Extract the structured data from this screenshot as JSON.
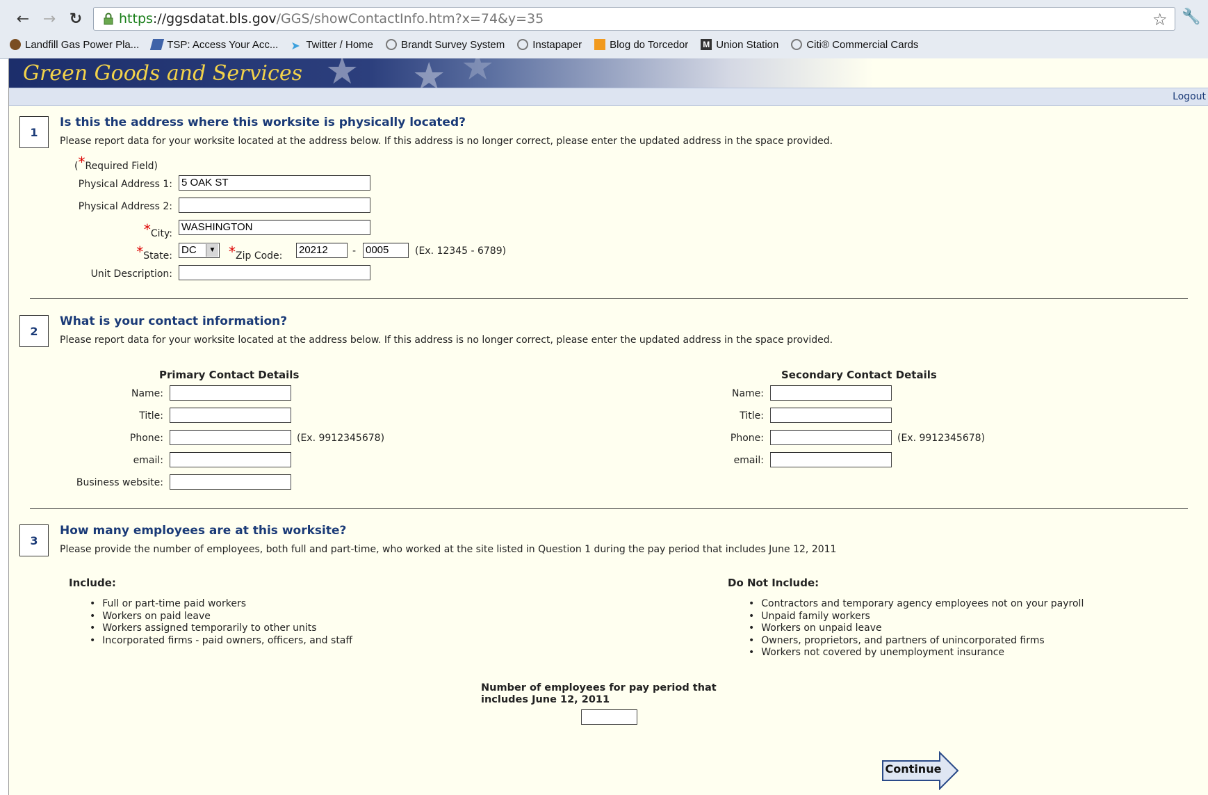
{
  "browser": {
    "url_scheme": "https",
    "url_host": "://ggsdatat.bls.gov",
    "url_rest": "/GGS/showContactInfo.htm?x=74&y=35",
    "bookmarks": [
      {
        "label": "Landfill Gas Power Pla...",
        "icon": "landfill-icon"
      },
      {
        "label": "TSP: Access Your Acc...",
        "icon": "tsp-icon"
      },
      {
        "label": "Twitter / Home",
        "icon": "twitter-icon"
      },
      {
        "label": "Brandt Survey System",
        "icon": "globe-icon"
      },
      {
        "label": "Instapaper",
        "icon": "globe-icon"
      },
      {
        "label": "Blog do Torcedor",
        "icon": "blog-icon"
      },
      {
        "label": "Union Station",
        "icon": "union-icon"
      },
      {
        "label": "Citi® Commercial Cards",
        "icon": "globe-icon"
      }
    ]
  },
  "header": {
    "title": "Green Goods and Services",
    "logout": "Logout"
  },
  "q1": {
    "number": "1",
    "title": "Is this the address where this worksite is physically located?",
    "desc": "Please report data for your worksite located at the address below. If this address is no longer correct, please enter the updated address in the space provided.",
    "required_open": "(",
    "required_star": "*",
    "required_text": "Required Field)",
    "addr1_label": "Physical Address 1:",
    "addr1_value": "5 OAK ST",
    "addr2_label": "Physical Address 2:",
    "addr2_value": "",
    "city_label": "City:",
    "city_value": "WASHINGTON",
    "state_label": "State:",
    "state_value": "DC",
    "zip_label": "Zip Code:",
    "zip_value": "20212",
    "zip_dash": "-",
    "zip4_value": "0005",
    "zip_example": "(Ex. 12345 - 6789)",
    "unit_label": "Unit Description:",
    "unit_value": ""
  },
  "q2": {
    "number": "2",
    "title": "What is your contact information?",
    "desc": "Please report data for your worksite located at the address below. If this address is no longer correct, please enter the updated address in the space provided.",
    "primary_heading": "Primary Contact Details",
    "secondary_heading": "Secondary Contact Details",
    "name_label": "Name:",
    "title_label": "Title:",
    "phone_label": "Phone:",
    "email_label": "email:",
    "website_label": "Business website:",
    "phone_example": "(Ex. 9912345678)"
  },
  "q3": {
    "number": "3",
    "title": "How many employees are at this worksite?",
    "desc": "Please provide the number of employees, both full and part-time, who worked at the site listed in Question 1 during the pay period that includes June 12, 2011",
    "include_heading": "Include:",
    "include_items": [
      "Full or part-time paid workers",
      "Workers on paid leave",
      "Workers assigned temporarily to other units",
      "Incorporated firms - paid owners, officers, and staff"
    ],
    "exclude_heading": "Do Not Include:",
    "exclude_items": [
      "Contractors and temporary agency employees not on your payroll",
      "Unpaid family workers",
      "Workers on unpaid leave",
      "Owners, proprietors, and partners of unincorporated firms",
      "Workers not covered by unemployment insurance"
    ],
    "count_label_line1": "Number of employees for pay period that",
    "count_label_line2": "includes June 12, 2011",
    "count_value": ""
  },
  "continue_label": "Continue",
  "colors": {
    "accent": "#1a3a77",
    "banner_title": "#f3d34a",
    "page_bg": "#fffff0",
    "required": "#dd0000"
  }
}
